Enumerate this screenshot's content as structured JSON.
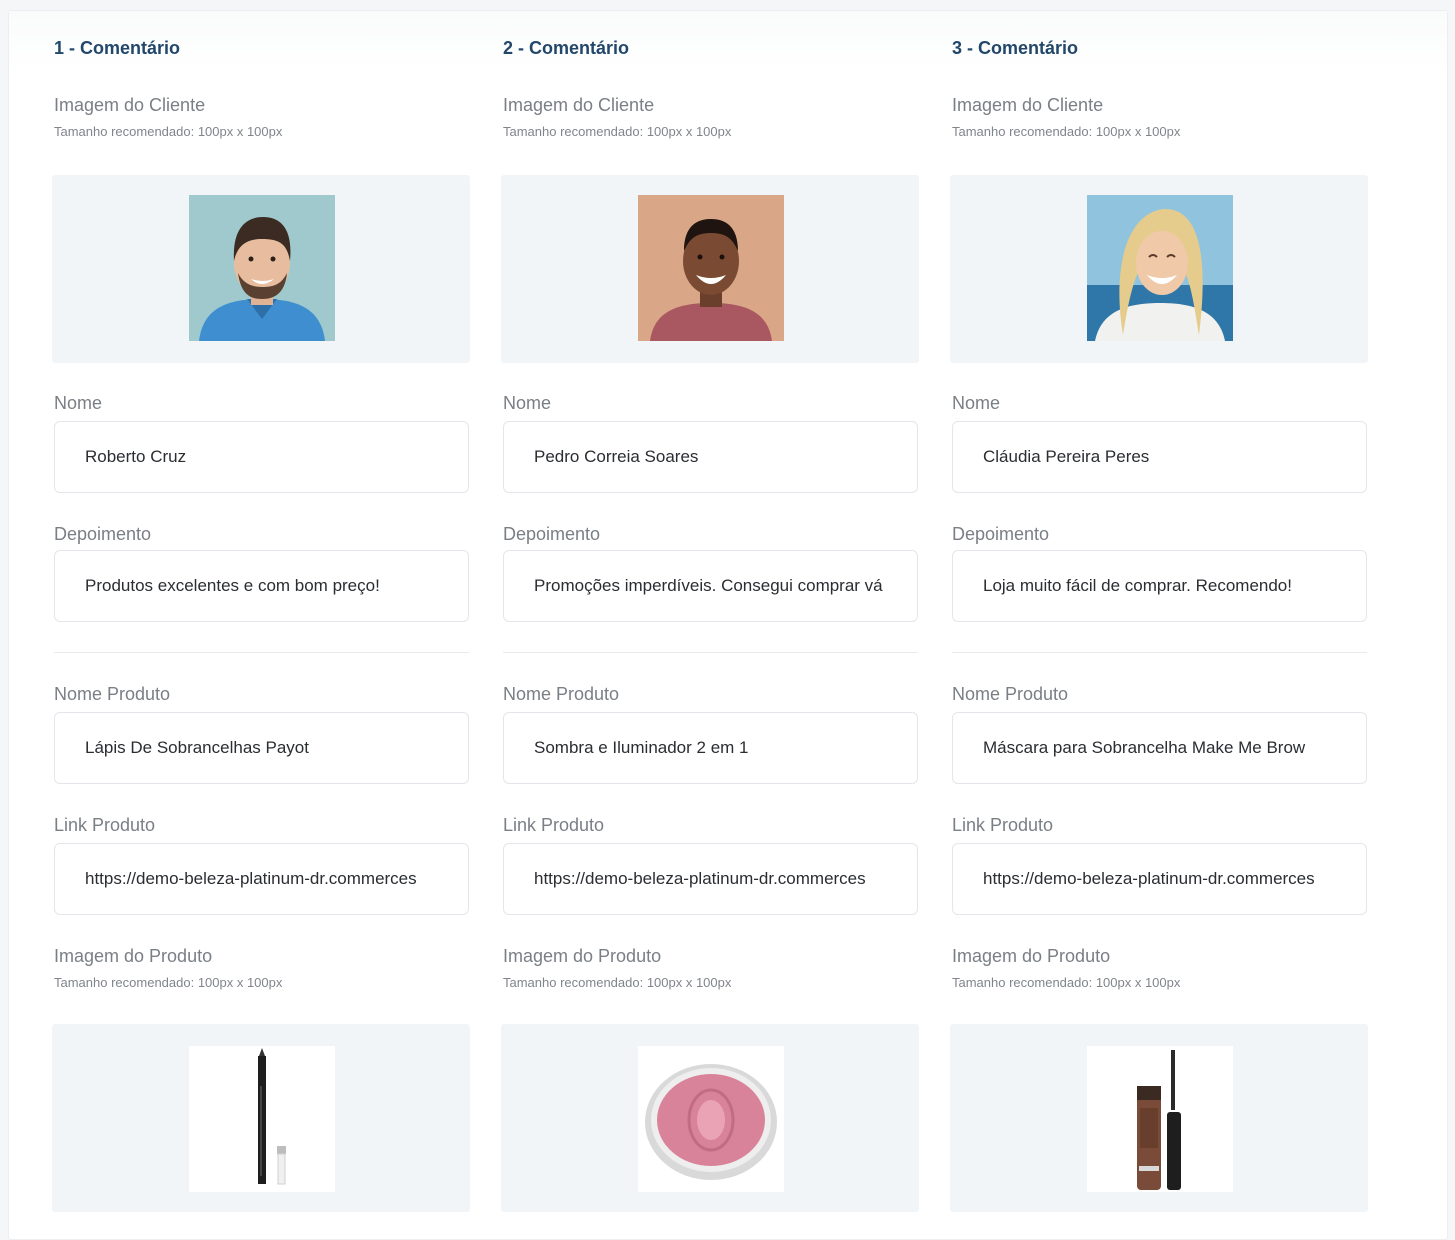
{
  "columns": [
    {
      "title": "1 - Comentário",
      "client_image_label": "Imagem do Cliente",
      "client_image_hint": "Tamanho recomendado: 100px x 100px",
      "client_photo_icon": "man-smiling-blue-shirt-photo",
      "name_label": "Nome",
      "name_value": "Roberto Cruz",
      "testimonial_label": "Depoimento",
      "testimonial_value": "Produtos excelentes e com bom preço!",
      "product_name_label": "Nome Produto",
      "product_name_value": "Lápis De Sobrancelhas Payot",
      "product_link_label": "Link Produto",
      "product_link_value": "https://demo-beleza-platinum-dr.commerces",
      "product_image_label": "Imagem do Produto",
      "product_image_hint": "Tamanho recomendado: 100px x 100px",
      "product_photo_icon": "eyebrow-pencil-photo"
    },
    {
      "title": "2 - Comentário",
      "client_image_label": "Imagem do Cliente",
      "client_image_hint": "Tamanho recomendado: 100px x 100px",
      "client_photo_icon": "man-smiling-red-shirt-photo",
      "name_label": "Nome",
      "name_value": "Pedro Correia Soares",
      "testimonial_label": "Depoimento",
      "testimonial_value": "Promoções imperdíveis. Consegui comprar vá",
      "product_name_label": "Nome Produto",
      "product_name_value": "Sombra e Iluminador 2 em 1",
      "product_link_label": "Link Produto",
      "product_link_value": "https://demo-beleza-platinum-dr.commerces",
      "product_image_label": "Imagem do Produto",
      "product_image_hint": "Tamanho recomendado: 100px x 100px",
      "product_photo_icon": "pink-blush-compact-photo"
    },
    {
      "title": "3 - Comentário",
      "client_image_label": "Imagem do Cliente",
      "client_image_hint": "Tamanho recomendado: 100px x 100px",
      "client_photo_icon": "woman-smiling-beach-photo",
      "name_label": "Nome",
      "name_value": "Cláudia Pereira Peres",
      "testimonial_label": "Depoimento",
      "testimonial_value": "Loja muito fácil de comprar. Recomendo!",
      "product_name_label": "Nome Produto",
      "product_name_value": "Máscara para Sobrancelha Make Me Brow",
      "product_link_label": "Link Produto",
      "product_link_value": "https://demo-beleza-platinum-dr.commerces",
      "product_image_label": "Imagem do Produto",
      "product_image_hint": "Tamanho recomendado: 100px x 100px",
      "product_photo_icon": "brow-mascara-tube-photo"
    }
  ]
}
